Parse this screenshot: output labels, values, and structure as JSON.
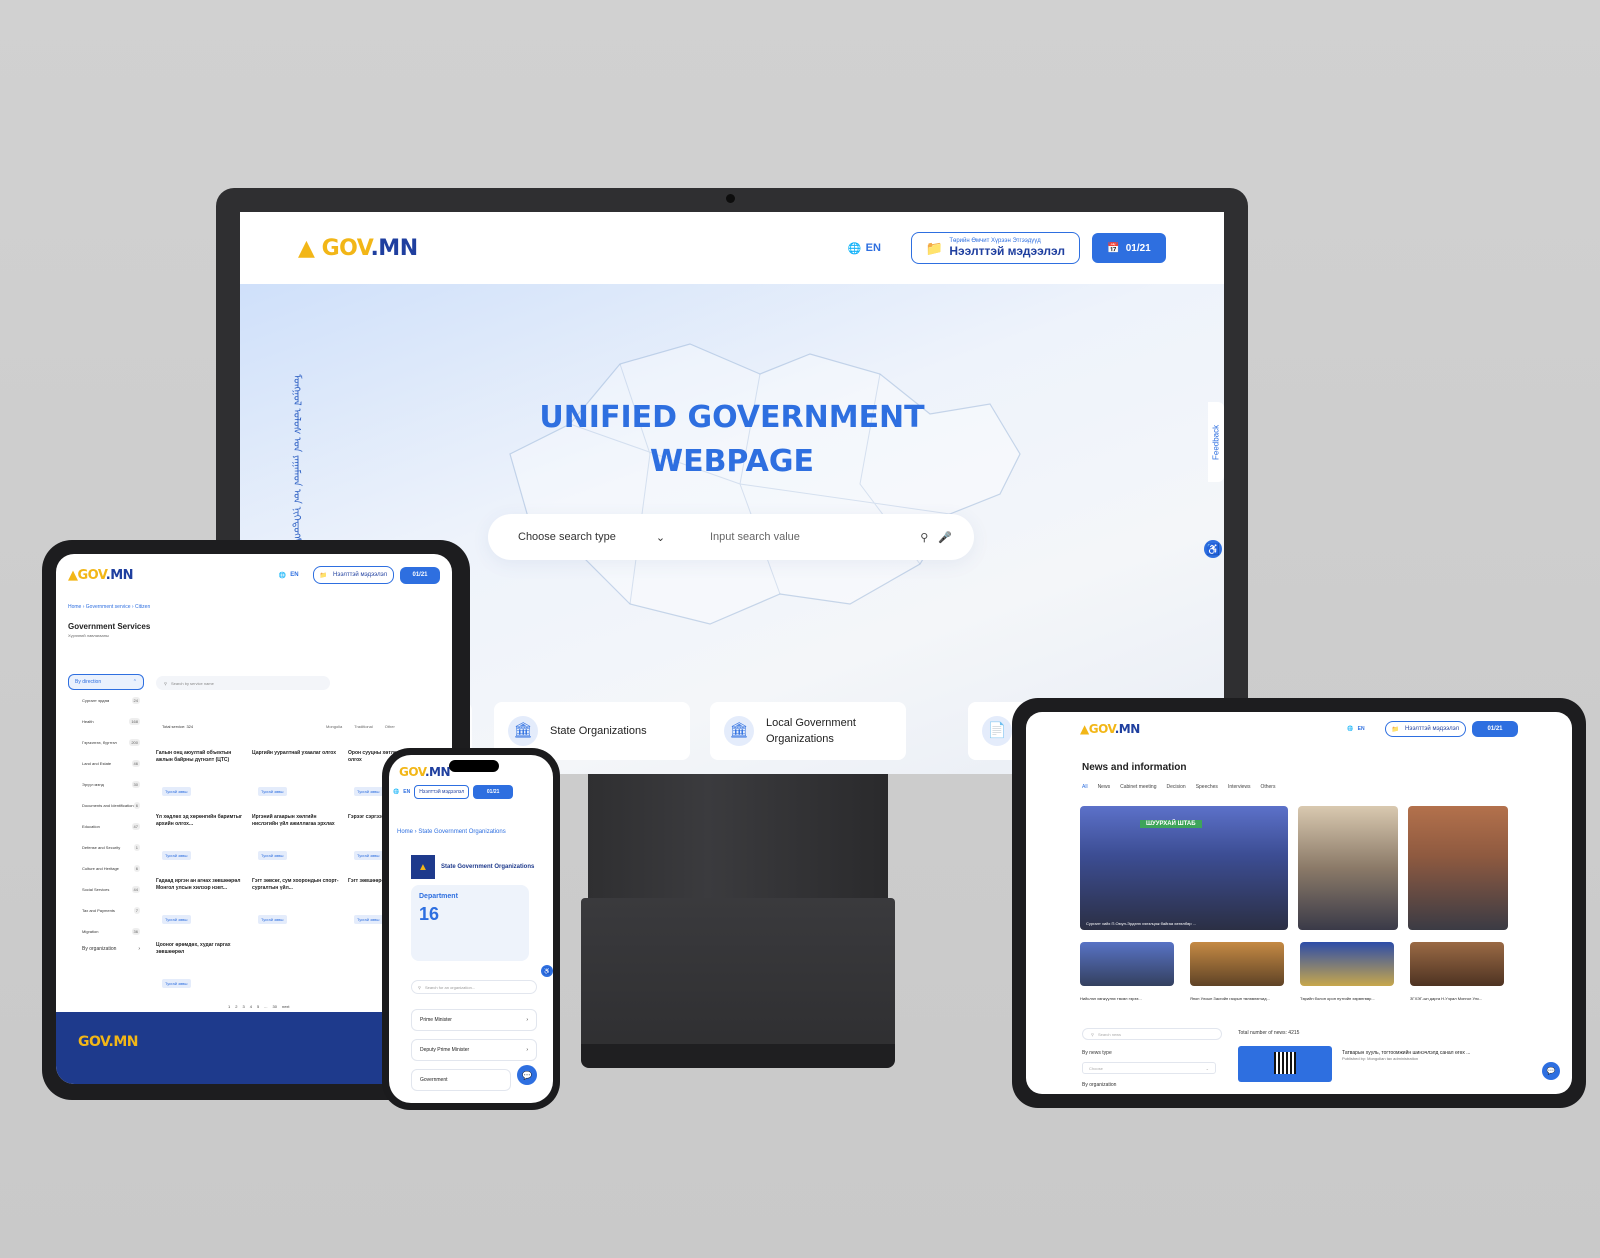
{
  "brand": {
    "logo_gov": "GOV",
    "logo_mn": ".MN",
    "logo_icon": "soyombo-icon"
  },
  "colors": {
    "primary": "#2e6fe0",
    "navy": "#1e3a8c",
    "gold": "#f2b617"
  },
  "header": {
    "lang": "EN",
    "outline_small": "Төрийн Өмчит Хүрээн Этгээдүүд",
    "outline_main": "Нээлттэй мэдээлэл",
    "date_button": "01/21"
  },
  "monitor": {
    "hero_title_line1": "UNIFIED GOVERNMENT",
    "hero_title_line2": "WEBPAGE",
    "search_type": "Choose search type",
    "search_placeholder": "Input search value",
    "feedback": "Feedback",
    "vertical_script": "ᠮᠣᠩᠭᠣᠯ ᠤᠯᠤᠰ ᠤᠨ ᠶᠠᠭᠠᠮᠠᠳ ᠤᠨ ᠨᠢᠭᠡᠳᠦᠭᠰᠡᠨ",
    "cards": [
      {
        "label": "State Organizations",
        "icon": "state-building-icon"
      },
      {
        "label": "Local Government Organizations",
        "icon": "local-building-icon"
      }
    ]
  },
  "tablet_left": {
    "breadcrumb": "Home  ›  Government service  ›  Citizen",
    "title": "Government Services",
    "subtitle": "Хүрээний лавлагааны",
    "by_direction": "By direction",
    "sidebar_items": [
      {
        "label": "Сургалт эрдэм",
        "count": "24"
      },
      {
        "label": "Health",
        "count": "168"
      },
      {
        "label": "Гэрчилгээ, бүртгэл",
        "count": "200"
      },
      {
        "label": "Land and Estate",
        "count": "46"
      },
      {
        "label": "Эрүүл мэнд",
        "count": "30"
      },
      {
        "label": "Documents and Identification",
        "count": "6"
      },
      {
        "label": "Education",
        "count": "47"
      },
      {
        "label": "Defense and Security",
        "count": "1"
      },
      {
        "label": "Culture and Heritage",
        "count": "6"
      },
      {
        "label": "Social Services",
        "count": "44"
      },
      {
        "label": "Tax and Payments",
        "count": "7"
      },
      {
        "label": "Migration",
        "count": "36"
      }
    ],
    "by_organization": "By organization",
    "search_placeholder": "Search by service name",
    "total": "Total service: 324",
    "filters": [
      "Mongolia",
      "Traditional",
      "Other"
    ],
    "services": [
      {
        "text": "Галын онц аюултай объектын ажлын байрны дүгнэлт (ЦТС)",
        "tag": "Тусгай зөвш"
      },
      {
        "text": "Царгийн ууралтнай ухаалаг олгох",
        "tag": "Тусгай зөвш"
      },
      {
        "text": "Орон сууцны хөтлөх шилжүүлэх олгох",
        "tag": "Тусгай зөвш"
      },
      {
        "text": "Үл хөдлөх эд хөрөнгийн баримтыг архийн олгох...",
        "tag": "Тусгай зөвш"
      },
      {
        "text": "Иргэний агаарын хөлгийн нислэгийн үйл ажиллагаа эрхлах",
        "tag": "Тусгай зөвш"
      },
      {
        "text": "Гэрээг сэргээх (Нөхөн олгох)",
        "tag": "Тусгай зөвш"
      },
      {
        "text": "Гадаад иргэн ан агнах зөвшөөрөл Монгол улсын хилээр нэвт...",
        "tag": "Тусгай зөвш"
      },
      {
        "text": "Гэгт зөвсөг, сум хоорондын спорт-сургалтын үйл...",
        "tag": "Тусгай зөвш"
      },
      {
        "text": "Гэгт зөвшөөрөл (Иргэн)",
        "tag": "Тусгай зөвш"
      },
      {
        "text": "Цооног өрөмдөх, худаг гаргах зөвшөөрөл",
        "tag": "Тусгай зөвш"
      }
    ],
    "pages": [
      "1",
      "2",
      "3",
      "4",
      "5",
      "...",
      "30",
      "next"
    ]
  },
  "phone": {
    "breadcrumb": "Home  ›  State Government Organizations",
    "org_title": "State Government Organizations",
    "dept_label": "Department",
    "dept_count": "16",
    "search_placeholder": "Search for an organization...",
    "items": [
      "Prime Minister",
      "Deputy Prime Minister",
      "Government"
    ]
  },
  "tablet_right": {
    "title": "News and information",
    "tabs": [
      "All",
      "News",
      "Cabinet meeting",
      "Decision",
      "Speeches",
      "Interviews",
      "Others"
    ],
    "big_caption": "Сургалт хийх П.Оюун-Эрдэнэ хэлэлцэж байгаа хөтөлбөр ...",
    "banner": "ШУУРХАЙ ШТАБ",
    "small_captions": [
      "Нийслэл хөгжүүлэх төсөл гэрээ...",
      "Япон Улсын Засгийн газрын төлөөлөгчид...",
      "Төрийн болон орон нутгийн хөрөнгөөр...",
      "ЗГХЭГ-ын дарга Н.Учрал Монгол Улс..."
    ],
    "search_placeholder": "Search news",
    "total": "Total number of news: 4215",
    "by_news_type": "By news type",
    "select_placeholder": "Choose",
    "by_organization": "By organization",
    "featured_news": "Татварын хууль, тогтоомжийн шинэчлэлд санал өгөх ...",
    "featured_source": "Published by: Mongolian tax administration"
  }
}
